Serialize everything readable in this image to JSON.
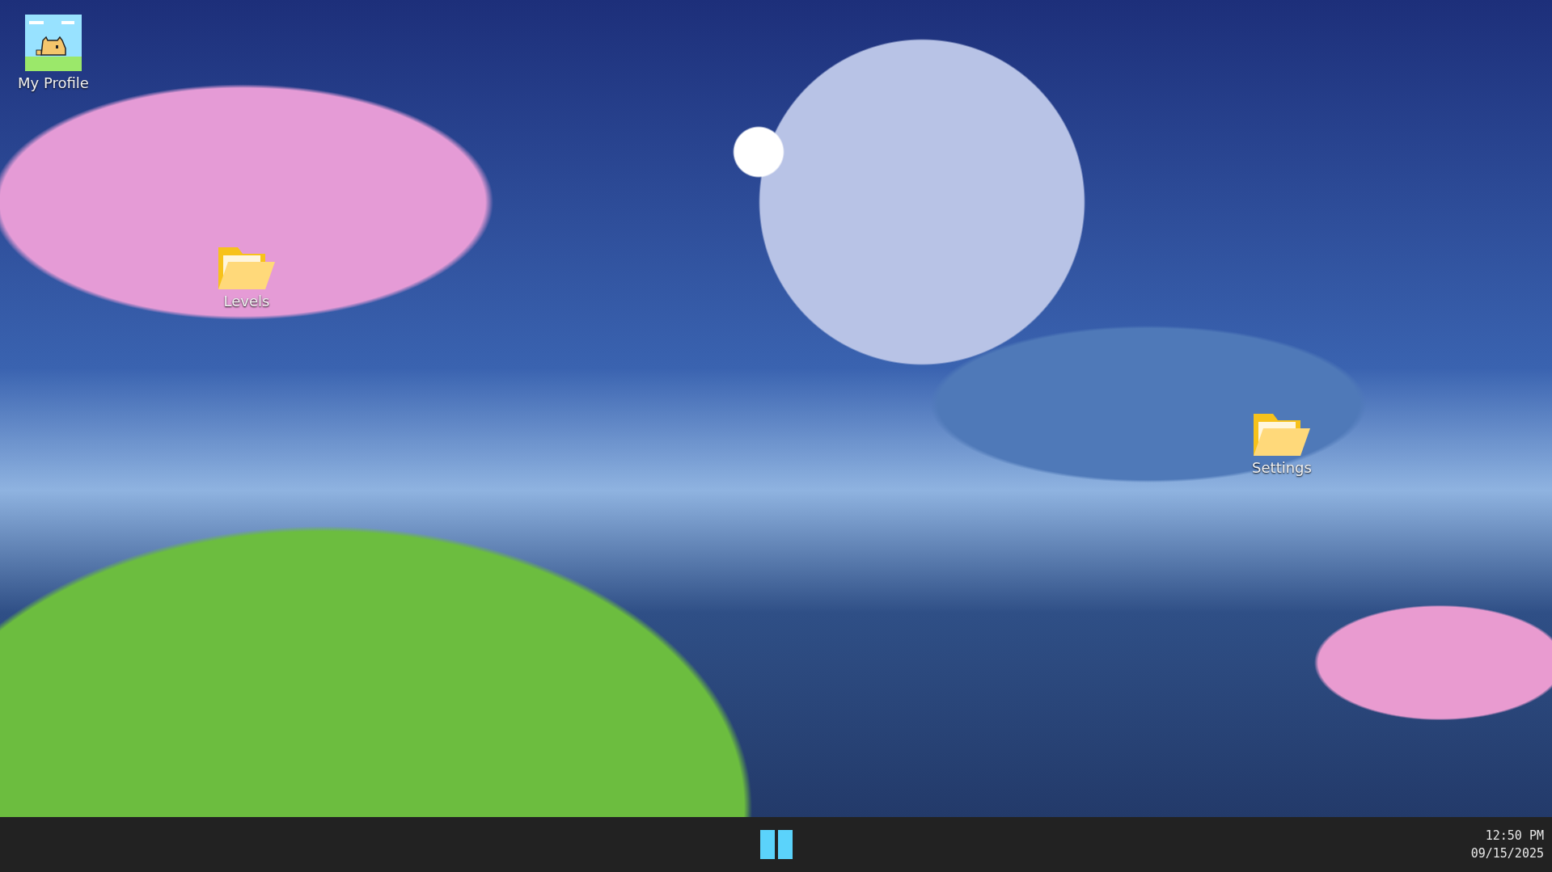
{
  "desktop_icons": [
    {
      "label": "My Profile",
      "kind": "profile"
    },
    {
      "label": "Levels",
      "kind": "folder"
    },
    {
      "label": "Settings",
      "kind": "folder"
    }
  ],
  "taskbar": {
    "clock": {
      "time": "12:50 PM",
      "date": "09/15/2025"
    }
  }
}
